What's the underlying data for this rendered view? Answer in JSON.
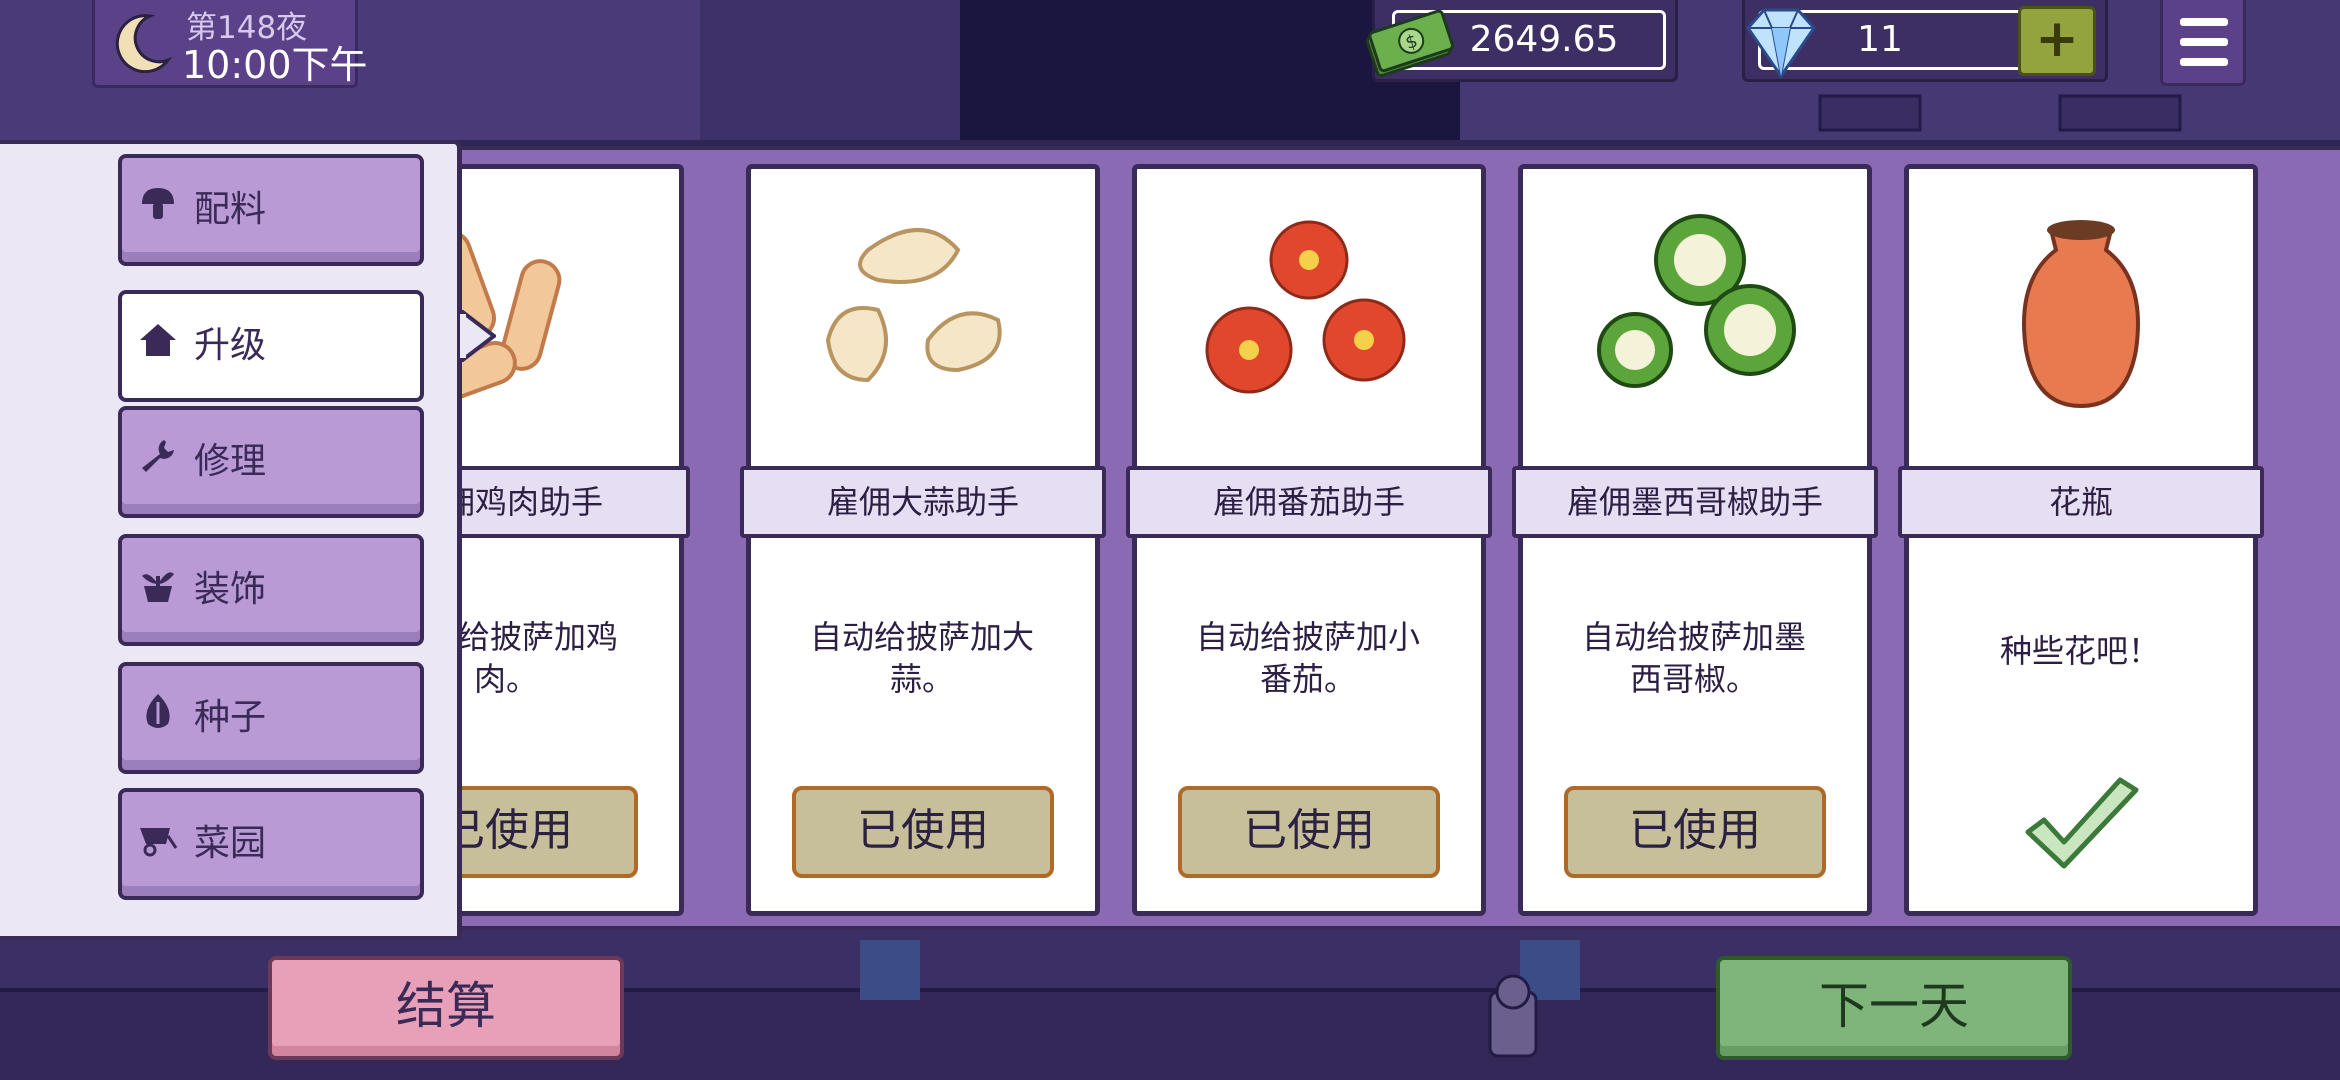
{
  "hud": {
    "night": "第148夜",
    "time": "10:00下午",
    "money": "2649.65",
    "gems": "11",
    "add_gems_label": "+"
  },
  "sidebar": {
    "tabs": [
      {
        "label": "配料",
        "icon": "mushroom-icon"
      },
      {
        "label": "升级",
        "icon": "house-icon",
        "active": true
      },
      {
        "label": "修理",
        "icon": "wrench-icon"
      },
      {
        "label": "装饰",
        "icon": "potted-plant-icon"
      },
      {
        "label": "种子",
        "icon": "seed-icon"
      },
      {
        "label": "菜园",
        "icon": "wheelbarrow-icon"
      }
    ]
  },
  "cards": [
    {
      "name": "雇佣鸡肉助手",
      "desc1": "自动给披萨加鸡",
      "desc2": "肉。",
      "button": "已使用",
      "icon": "chicken-strips-icon"
    },
    {
      "name": "雇佣大蒜助手",
      "desc1": "自动给披萨加大",
      "desc2": "蒜。",
      "button": "已使用",
      "icon": "garlic-cloves-icon"
    },
    {
      "name": "雇佣番茄助手",
      "desc1": "自动给披萨加小",
      "desc2": "番茄。",
      "button": "已使用",
      "icon": "tomato-slices-icon"
    },
    {
      "name": "雇佣墨西哥椒助手",
      "desc1": "自动给披萨加墨",
      "desc2": "西哥椒。",
      "button": "已使用",
      "icon": "jalapeno-slices-icon"
    },
    {
      "name": "花瓶",
      "desc1": "种些花吧！",
      "desc2": "",
      "button": "",
      "icon": "vase-icon",
      "status_icon": "checkmark-icon"
    }
  ],
  "bottom": {
    "checkout_label": "结算",
    "next_day_label": "下一天"
  },
  "colors": {
    "panel_bg": "#8a6ab3",
    "tab_bg": "#b99ad5",
    "outline": "#3a2a58",
    "used_button": "#c7be9a",
    "checkout": "#e8a0b8",
    "next_day": "#7fb57b"
  }
}
